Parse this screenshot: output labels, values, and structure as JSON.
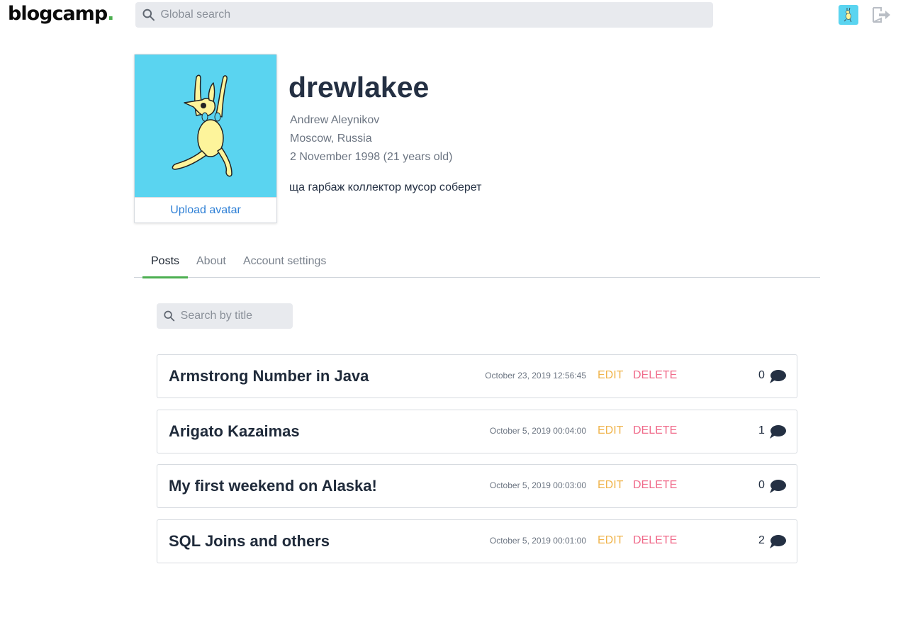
{
  "header": {
    "logo_text": "blogcamp",
    "logo_dot": ".",
    "search_placeholder": "Global search"
  },
  "profile": {
    "username": "drewlakee",
    "full_name": "Andrew Aleynikov",
    "location": "Moscow, Russia",
    "birthdate": "2 November 1998 (21 years old)",
    "bio": "ща гарбаж коллектор мусор соберет",
    "upload_label": "Upload avatar",
    "avatar_bg": "#5ad4f0"
  },
  "tabs": [
    {
      "label": "Posts",
      "active": true
    },
    {
      "label": "About",
      "active": false
    },
    {
      "label": "Account settings",
      "active": false
    }
  ],
  "title_search": {
    "placeholder": "Search by title"
  },
  "post_actions": {
    "edit": "EDIT",
    "delete": "DELETE"
  },
  "posts": [
    {
      "title": "Armstrong Number in Java",
      "date": "October 23, 2019 12:56:45",
      "comments": "0"
    },
    {
      "title": "Arigato Kazaimas",
      "date": "October 5, 2019 00:04:00",
      "comments": "1"
    },
    {
      "title": "My first weekend on Alaska!",
      "date": "October 5, 2019 00:03:00",
      "comments": "0"
    },
    {
      "title": "SQL Joins and others",
      "date": "October 5, 2019 00:01:00",
      "comments": "2"
    }
  ],
  "colors": {
    "accent_green": "#4caf50",
    "link_blue": "#2f80d6",
    "edit": "#f0b44c",
    "delete": "#f06a8a"
  },
  "icons": [
    "search-icon",
    "logout-icon",
    "comment-icon"
  ]
}
